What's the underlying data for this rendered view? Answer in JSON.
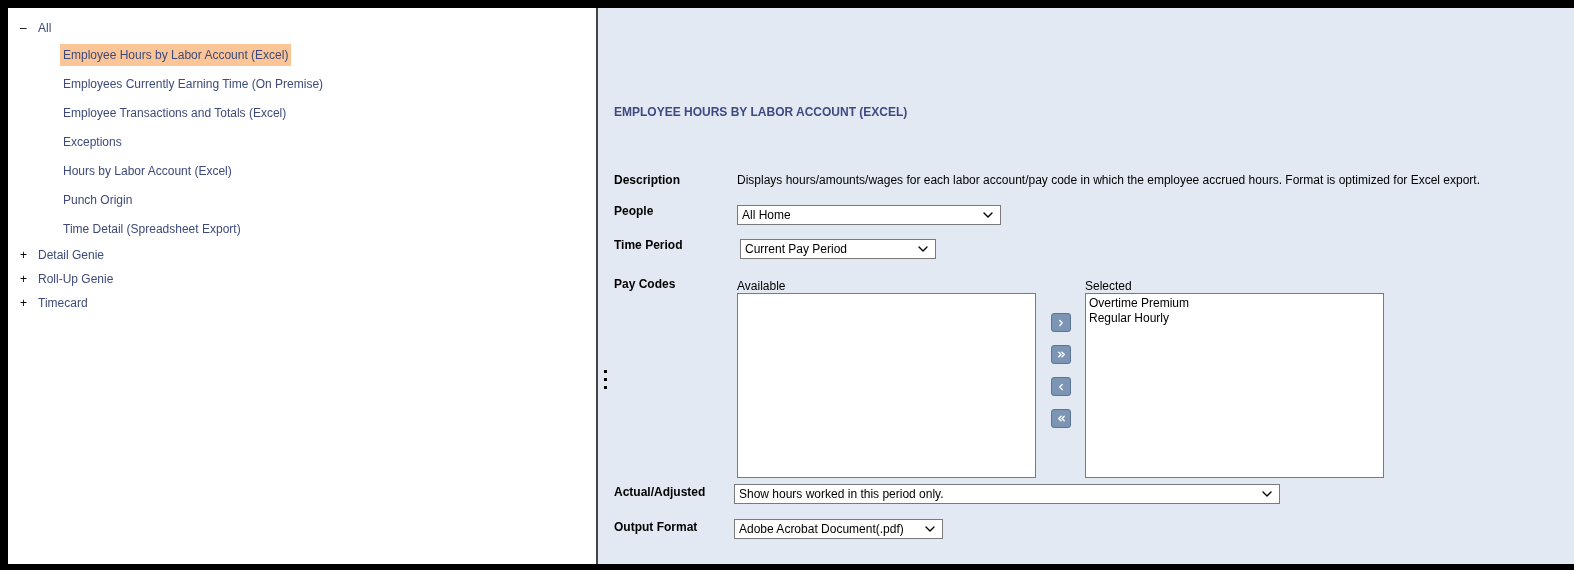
{
  "tree": [
    {
      "label": "All",
      "expanded": true,
      "children": [
        {
          "label": "Employee Hours by Labor Account (Excel)",
          "selected": true
        },
        {
          "label": "Employees Currently Earning Time (On Premise)",
          "selected": false
        },
        {
          "label": "Employee Transactions and Totals (Excel)",
          "selected": false
        },
        {
          "label": "Exceptions",
          "selected": false
        },
        {
          "label": "Hours by Labor Account (Excel)",
          "selected": false
        },
        {
          "label": "Punch Origin",
          "selected": false
        },
        {
          "label": "Time Detail (Spreadsheet Export)",
          "selected": false
        }
      ]
    },
    {
      "label": "Detail Genie",
      "expanded": false
    },
    {
      "label": "Roll-Up Genie",
      "expanded": false
    },
    {
      "label": "Timecard",
      "expanded": false
    }
  ],
  "tree_toggle": {
    "expanded": "–",
    "collapsed": "+"
  },
  "report": {
    "title": "EMPLOYEE HOURS BY LABOR ACCOUNT (EXCEL)",
    "description_label": "Description",
    "description": "Displays hours/amounts/wages for each labor account/pay code in which the employee accrued hours. Format is optimized for Excel export.",
    "people_label": "People",
    "people": "All Home",
    "time_period_label": "Time Period",
    "time_period": "Current Pay Period",
    "pay_codes_label": "Pay Codes",
    "available_label": "Available",
    "selected_label": "Selected",
    "selected": [
      "Overtime Premium",
      "Regular Hourly"
    ],
    "actual_adjusted_label": "Actual/Adjusted",
    "actual_adjusted": "Show hours worked in this period only.",
    "output_format_label": "Output Format",
    "output_format": "Adobe Acrobat Document(.pdf)"
  }
}
